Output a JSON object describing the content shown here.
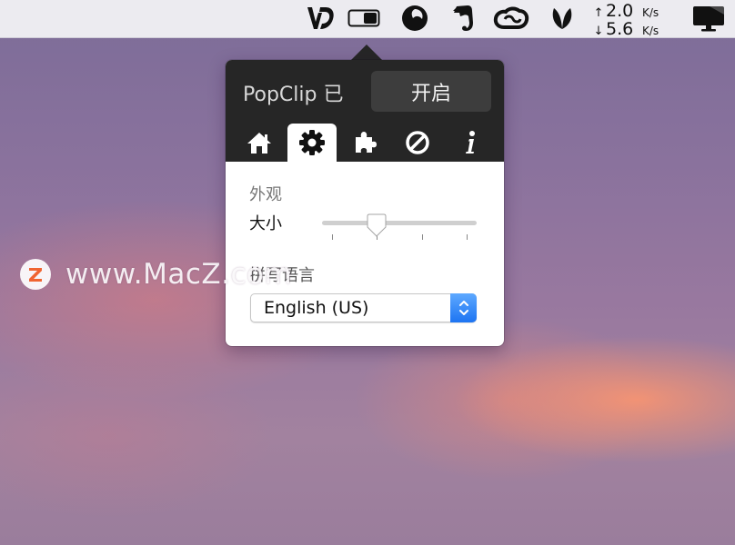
{
  "menubar": {
    "icons": [
      "dictionary-icon",
      "toggle-icon",
      "moon-app-icon",
      "evernote-icon",
      "creative-cloud-icon",
      "leaf-icon",
      "display-icon"
    ],
    "net_speed": {
      "upload_arrow": "↑",
      "upload_value": "2.0",
      "upload_unit": "K/s",
      "download_arrow": "↓",
      "download_value": "5.6",
      "download_unit": "K/s"
    }
  },
  "popover": {
    "title": "PopClip 已",
    "enable_label": "开启",
    "tabs": [
      {
        "icon": "home-icon",
        "active": false
      },
      {
        "icon": "gear-icon",
        "active": true
      },
      {
        "icon": "puzzle-icon",
        "active": false
      },
      {
        "icon": "blocked-icon",
        "active": false
      },
      {
        "icon": "info-icon",
        "active": false
      }
    ],
    "appearance_heading": "外观",
    "size_label": "大小",
    "size_level": 0.35,
    "language_heading": "拼写语言",
    "language_value": "English (US)"
  },
  "watermark": {
    "text": "www.MacZ.com",
    "logo_letter": "Z"
  },
  "colors": {
    "popover_header": "#262626",
    "select_accent": "#1d74f2",
    "watermark_logo": "#f06431"
  }
}
